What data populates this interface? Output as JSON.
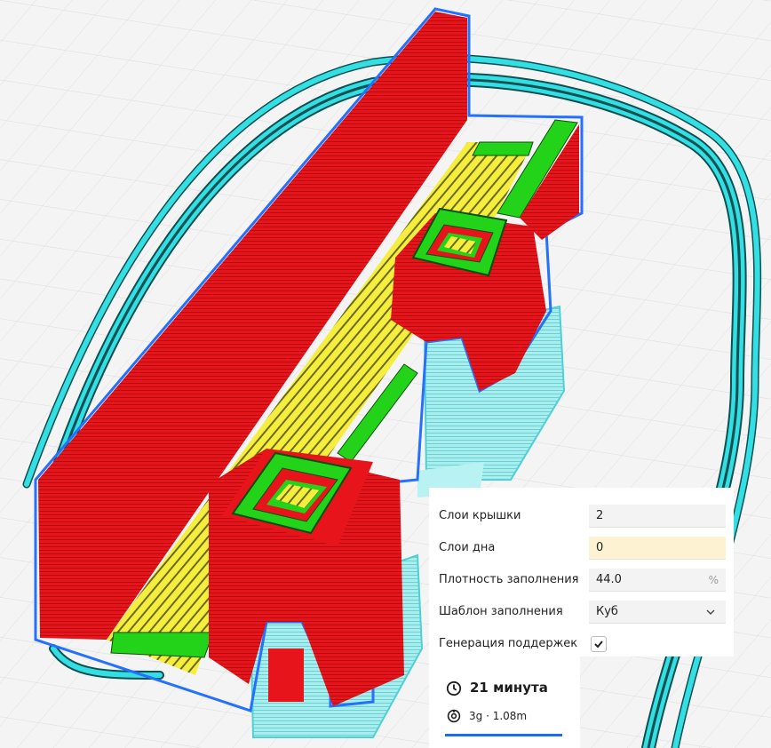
{
  "settings": {
    "top_layers": {
      "label": "Слои крышки",
      "value": "2"
    },
    "bottom_layers": {
      "label": "Слои дна",
      "value": "0"
    },
    "infill_density": {
      "label": "Плотность заполнения",
      "value": "44.0",
      "unit": "%"
    },
    "infill_pattern": {
      "label": "Шаблон заполнения",
      "value": "Куб"
    },
    "support": {
      "label": "Генерация поддержек",
      "checked": true
    }
  },
  "estimate": {
    "time": "21 минута",
    "material": "3g · 1.08m"
  },
  "icons": {
    "clock": "clock-icon",
    "spool": "spool-icon",
    "chevron": "chevron-down-icon",
    "check": "checkmark-icon"
  },
  "colors": {
    "wall_outer": "#e8141b",
    "infill": "#f5ee3c",
    "top_skin": "#22d31a",
    "support": "#5fe0e4",
    "skirt": "#1fd3d6",
    "outline_blue": "#2470ff",
    "accent": "#196ef0",
    "highlight_field": "#fdf3d3"
  }
}
